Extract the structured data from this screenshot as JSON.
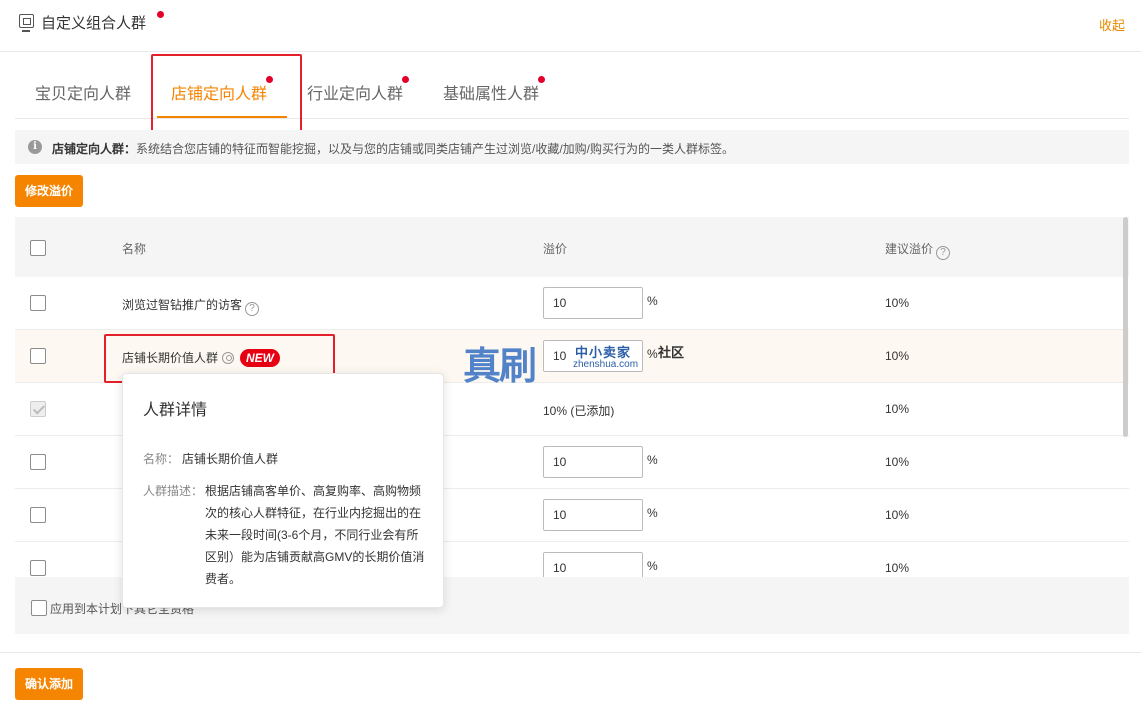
{
  "header": {
    "title": "自定义组合人群",
    "collapse_label": "收起"
  },
  "tabs": [
    {
      "label": "宝贝定向人群",
      "active": false
    },
    {
      "label": "店铺定向人群",
      "active": true
    },
    {
      "label": "行业定向人群",
      "active": false
    },
    {
      "label": "基础属性人群",
      "active": false
    }
  ],
  "info": {
    "label": "店铺定向人群：",
    "text": "系统结合您店铺的特征而智能挖掘，以及与您的店铺或同类店铺产生过浏览/收藏/加购/购买行为的一类人群标签。"
  },
  "buttons": {
    "modify_premium": "修改溢价",
    "confirm_add": "确认添加"
  },
  "table": {
    "columns": [
      "名称",
      "溢价",
      "建议溢价"
    ],
    "rows": [
      {
        "name": "浏览过智钻推广的访客",
        "premium": "10",
        "suggested": "10%"
      },
      {
        "name": "店铺长期价值人群",
        "badge": "NEW",
        "premium": "10",
        "suggested": "10%"
      },
      {
        "name": "",
        "premium_static": "10% (已添加)",
        "suggested": "10%"
      },
      {
        "name": "",
        "premium": "10",
        "suggested": "10%"
      },
      {
        "name": "",
        "premium": "10",
        "suggested": "10%"
      },
      {
        "name": "",
        "premium": "10",
        "suggested": "10%"
      }
    ],
    "percent_sign": "%",
    "help_glyph": "?"
  },
  "footer": {
    "apply_label": "应用到本计划下其它全资格"
  },
  "tooltip": {
    "title": "人群详情",
    "name_label": "名称：",
    "name_value": "店铺长期价值人群",
    "desc_label": "人群描述：",
    "desc_value": "根据店铺高客单价、高复购率、高购物频次的核心人群特征，在行业内挖掘出的在未来一段时间(3-6个月，不同行业会有所区别）能为店铺贡献高GMV的长期价值消费者。"
  },
  "watermark": {
    "main": "真刷",
    "top": "中小卖家",
    "bottom": "zhenshua.com",
    "suffix": "社区"
  },
  "icons": {
    "header": "screen-icon",
    "info": "info-icon",
    "help": "question-circle-icon",
    "user": "user-circle-icon"
  },
  "colors": {
    "accent": "#f58400",
    "highlight": "#e4202b",
    "badge": "#e60012",
    "dot": "#e4002b"
  }
}
